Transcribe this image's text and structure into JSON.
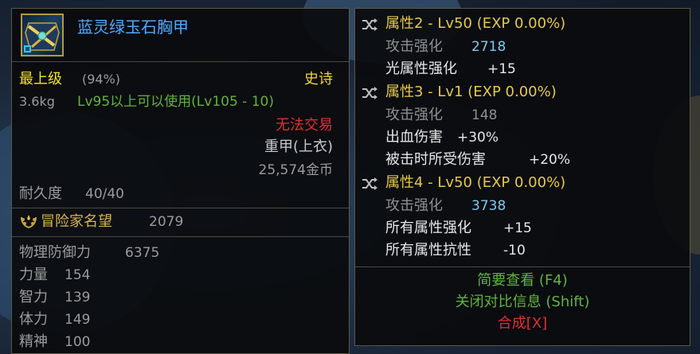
{
  "item": {
    "name": "蓝灵绿玉石胸甲",
    "grade": "最上级",
    "grade_percent": "(94%)",
    "rarity": "史诗",
    "weight": "3.6kg",
    "level_req": "Lv95以上可以使用(Lv105 - 10)",
    "trade": "无法交易",
    "type": "重甲(上衣)",
    "price": "25,574金币",
    "durability_label": "耐久度",
    "durability_value": "40/40",
    "fame_label": "冒险家名望",
    "fame_value": "2079"
  },
  "stats": [
    {
      "label": "物理防御力",
      "value": "6375"
    },
    {
      "label": "力量",
      "value": "154"
    },
    {
      "label": "智力",
      "value": "139"
    },
    {
      "label": "体力",
      "value": "149"
    },
    {
      "label": "精神",
      "value": "100"
    }
  ],
  "attributes": {
    "attr2": {
      "header": "属性2 - Lv50 (EXP 0.00%)",
      "lines": [
        {
          "label": "攻击强化",
          "value": "2718"
        },
        {
          "label": "光属性强化",
          "value": "+15"
        }
      ]
    },
    "attr3": {
      "header": "属性3 - Lv1 (EXP 0.00%)",
      "lines": [
        {
          "label": "攻击强化",
          "value": "148"
        },
        {
          "label": "出血伤害",
          "value": "+30%"
        },
        {
          "label": "被击时所受伤害",
          "value": "+20%"
        }
      ]
    },
    "attr4": {
      "header": "属性4 - Lv50 (EXP 0.00%)",
      "lines": [
        {
          "label": "攻击强化",
          "value": "3738"
        },
        {
          "label": "所有属性强化",
          "value": "+15"
        },
        {
          "label": "所有属性抗性",
          "value": "-10"
        }
      ]
    }
  },
  "footer": {
    "summary": "简要查看 (F4)",
    "close_compare": "关闭对比信息 (Shift)",
    "synthesize": "合成[X]"
  },
  "colors": {
    "title": "#4fa9ff",
    "grade": "#f5e12a",
    "level_req": "#62b33b",
    "trade": "#e0302e",
    "attribute_header": "#e6c84a",
    "footer_green": "#62b33b",
    "footer_red": "#e0302e"
  },
  "icons": {
    "item": "epic-chest-armor-icon",
    "shuffle": "shuffle-icon",
    "fame": "fame-laurel-icon"
  }
}
